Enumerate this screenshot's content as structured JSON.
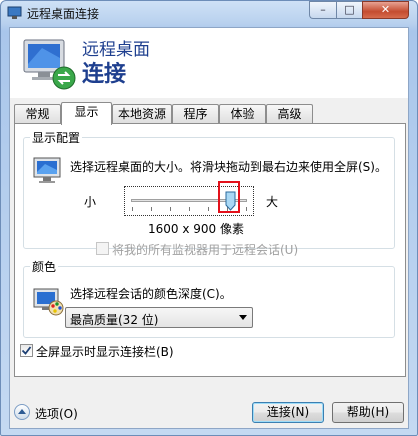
{
  "window": {
    "title": "远程桌面连接"
  },
  "title_controls": {
    "minimize": "–",
    "maximize": "□",
    "close": "✕"
  },
  "header": {
    "line1": "远程桌面",
    "line2": "连接"
  },
  "tabs": [
    {
      "label": "常规",
      "active": false
    },
    {
      "label": "显示",
      "active": true
    },
    {
      "label": "本地资源",
      "active": false
    },
    {
      "label": "程序",
      "active": false
    },
    {
      "label": "体验",
      "active": false
    },
    {
      "label": "高级",
      "active": false
    }
  ],
  "display_config": {
    "legend": "显示配置",
    "instruction": "选择远程桌面的大小。将滑块拖动到最右边来使用全屏(S)。",
    "slider": {
      "min_label": "小",
      "max_label": "大",
      "value_fraction": 0.86
    },
    "resolution": "1600 x 900 像素",
    "all_monitors_checkbox": {
      "label": "将我的所有监视器用于远程会话(U)",
      "checked": false,
      "disabled": true
    }
  },
  "colors": {
    "legend": "颜色",
    "instruction": "选择远程会话的颜色深度(C)。",
    "selected": "最高质量(32 位)"
  },
  "fullscreen_bar_checkbox": {
    "label": "全屏显示时显示连接栏(B)",
    "checked": true
  },
  "footer": {
    "options_label": "选项(O)",
    "connect_label": "连接(N)",
    "help_label": "帮助(H)"
  }
}
